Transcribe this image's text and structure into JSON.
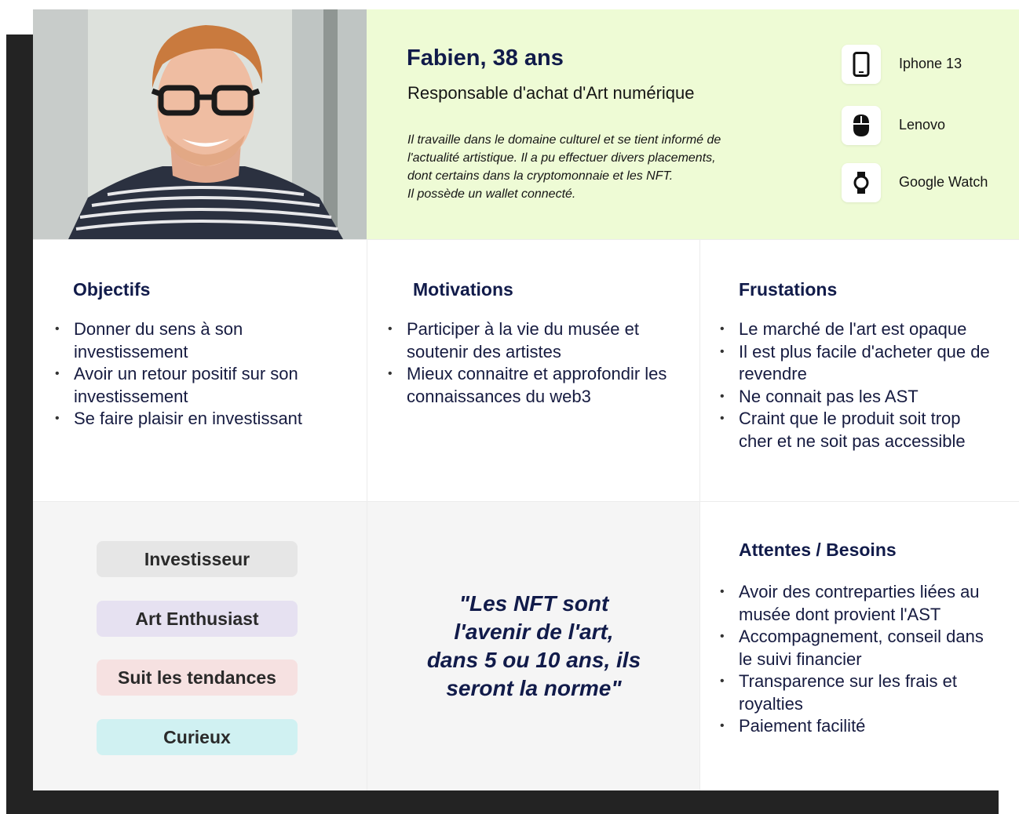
{
  "persona": {
    "name": "Fabien, 38 ans",
    "role": "Responsable d'achat d'Art numérique",
    "description": [
      "Il travaille dans le domaine culturel et se tient informé de",
      "l'actualité artistique. Il a pu effectuer divers placements,",
      "dont certains dans la cryptomonnaie et les NFT.",
      "Il possède un wallet connecté."
    ],
    "devices": [
      {
        "label": "Iphone 13",
        "icon": "smartphone-icon"
      },
      {
        "label": "Lenovo",
        "icon": "mouse-icon"
      },
      {
        "label": "Google Watch",
        "icon": "smartwatch-icon"
      }
    ]
  },
  "objectifs": {
    "title": "Objectifs",
    "items": [
      "Donner du sens à son investissement",
      "Avoir un retour positif sur son investissement",
      "Se faire plaisir en investissant"
    ]
  },
  "motivations": {
    "title": "Motivations",
    "items": [
      "Participer à la vie du musée et soutenir des artistes",
      "Mieux connaitre et approfondir les connaissances du web3"
    ]
  },
  "frustrations": {
    "title": "Frustations",
    "items": [
      "Le marché de l'art est opaque",
      "Il est plus facile d'acheter que de revendre",
      "Ne connait pas les AST",
      "Craint que le produit soit trop cher et ne soit pas accessible"
    ]
  },
  "tags": [
    {
      "label": "Investisseur",
      "color": "#e6e6e6"
    },
    {
      "label": "Art Enthusiast",
      "color": "#e6e1f1"
    },
    {
      "label": "Suit les tendances",
      "color": "#f6e1e1"
    },
    {
      "label": "Curieux",
      "color": "#d0f1f2"
    }
  ],
  "quote": {
    "lines": [
      "\"Les NFT sont",
      "l'avenir de l'art,",
      "dans 5 ou 10 ans, ils",
      "seront la norme\""
    ]
  },
  "attentes": {
    "title": "Attentes / Besoins",
    "items": [
      "Avoir des contreparties liées au musée dont provient l'AST",
      "Accompagnement, conseil dans le suivi financier",
      "Transparence sur les frais et royalties",
      "Paiement facilité"
    ]
  },
  "colors": {
    "heading": "#111b4a",
    "intro_bg": "#eefbd5",
    "gray_bg": "#f5f5f5",
    "frame_shadow": "#232323"
  }
}
